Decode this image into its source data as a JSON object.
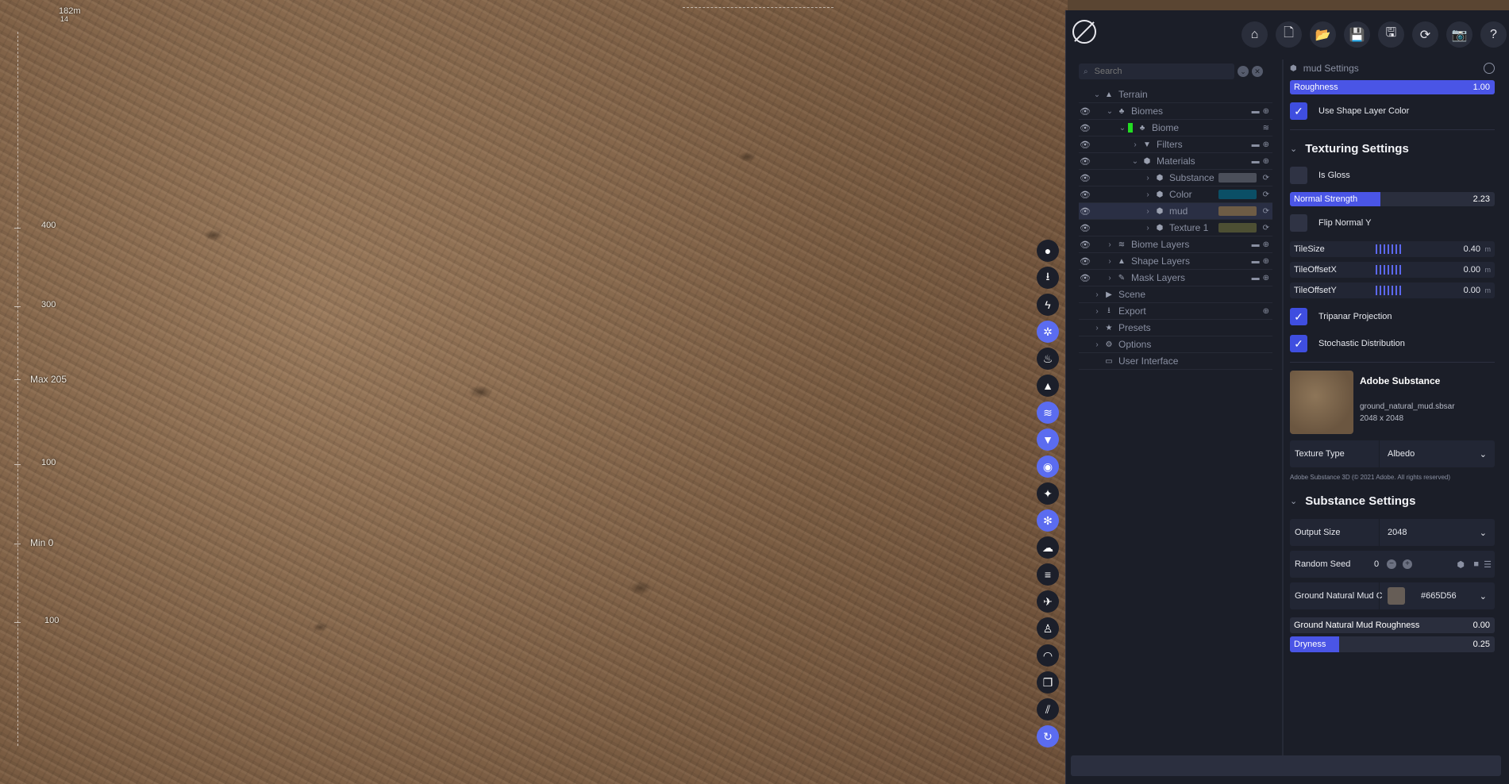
{
  "viewport": {
    "elevation_top": "182m",
    "elevation_top_sub": "14",
    "axis_labels": [
      "400",
      "300",
      "100",
      "100"
    ],
    "max_label": "Max 205",
    "min_label": "Min 0"
  },
  "vtoolbar": {
    "icons": [
      "record-icon",
      "download-icon",
      "bolt-icon",
      "gears-icon",
      "fire-icon",
      "mountain-icon",
      "layers-icon",
      "filter-icon",
      "eye-icon",
      "sparkle-icon",
      "snowflake-icon",
      "cloud-icon",
      "lines-icon",
      "plane-icon",
      "person-icon",
      "rainbow-icon",
      "copy-icon",
      "chart-icon",
      "refresh-icon"
    ],
    "active": [
      3,
      6,
      7,
      8,
      10,
      18
    ]
  },
  "topbar": {
    "icons": [
      "home-icon",
      "new-file-icon",
      "open-folder-icon",
      "save-icon",
      "save-as-icon",
      "reload-icon",
      "camera-icon",
      "help-icon"
    ]
  },
  "tree": {
    "search_placeholder": "Search",
    "items": [
      {
        "label": "Terrain",
        "indent": 0
      },
      {
        "label": "Biomes",
        "indent": 1
      },
      {
        "label": "Biome",
        "indent": 2
      },
      {
        "label": "Filters",
        "indent": 3
      },
      {
        "label": "Materials",
        "indent": 3
      },
      {
        "label": "Substance",
        "indent": 4
      },
      {
        "label": "Color",
        "indent": 4
      },
      {
        "label": "mud",
        "indent": 4
      },
      {
        "label": "Texture 1",
        "indent": 4
      },
      {
        "label": "Biome Layers",
        "indent": 1
      },
      {
        "label": "Shape Layers",
        "indent": 1
      },
      {
        "label": "Mask Layers",
        "indent": 1
      },
      {
        "label": "Scene",
        "indent": 0
      },
      {
        "label": "Export",
        "indent": 0
      },
      {
        "label": "Presets",
        "indent": 0
      },
      {
        "label": "Options",
        "indent": 0
      },
      {
        "label": "User Interface",
        "indent": 0
      }
    ],
    "swatches": {
      "Substance": "#4b4f5a",
      "Color": "#0b4f66",
      "mud": "#6e5c45",
      "Texture 1": "#4d4f33"
    },
    "selected": "mud"
  },
  "settings": {
    "title": "mud Settings",
    "roughness_label": "Roughness",
    "roughness_value": "1.00",
    "roughness_fraction": 1.0,
    "use_shape_layer_color": "Use Shape Layer Color",
    "texturing_title": "Texturing Settings",
    "is_gloss": "Is Gloss",
    "normal_strength_label": "Normal Strength",
    "normal_strength_value": "2.23",
    "normal_strength_fraction": 0.44,
    "flip_normal_y": "Flip Normal Y",
    "tilesize_label": "TileSize",
    "tilesize_value": "0.40",
    "tileoffsetx_label": "TileOffsetX",
    "tileoffsetx_value": "0.00",
    "tileoffsety_label": "TileOffsetY",
    "tileoffsety_value": "0.00",
    "unit": "m",
    "tripanar": "Tripanar Projection",
    "stochastic": "Stochastic Distribution",
    "substance_name": "Adobe Substance",
    "substance_file": "ground_natural_mud.sbsar",
    "substance_size": "2048 x 2048",
    "texture_type_label": "Texture Type",
    "texture_type_value": "Albedo",
    "copyright": "Adobe Substance 3D (© 2021 Adobe. All rights reserved)",
    "substance_settings_title": "Substance Settings",
    "output_size_label": "Output Size",
    "output_size_value": "2048",
    "random_seed_label": "Random Seed",
    "random_seed_value": "0",
    "mud_color_label": "Ground Natural Mud C",
    "mud_color_value": "#665D56",
    "mud_roughness_label": "Ground Natural Mud Roughness",
    "mud_roughness_value": "0.00",
    "dryness_label": "Dryness",
    "dryness_value": "0.25"
  }
}
